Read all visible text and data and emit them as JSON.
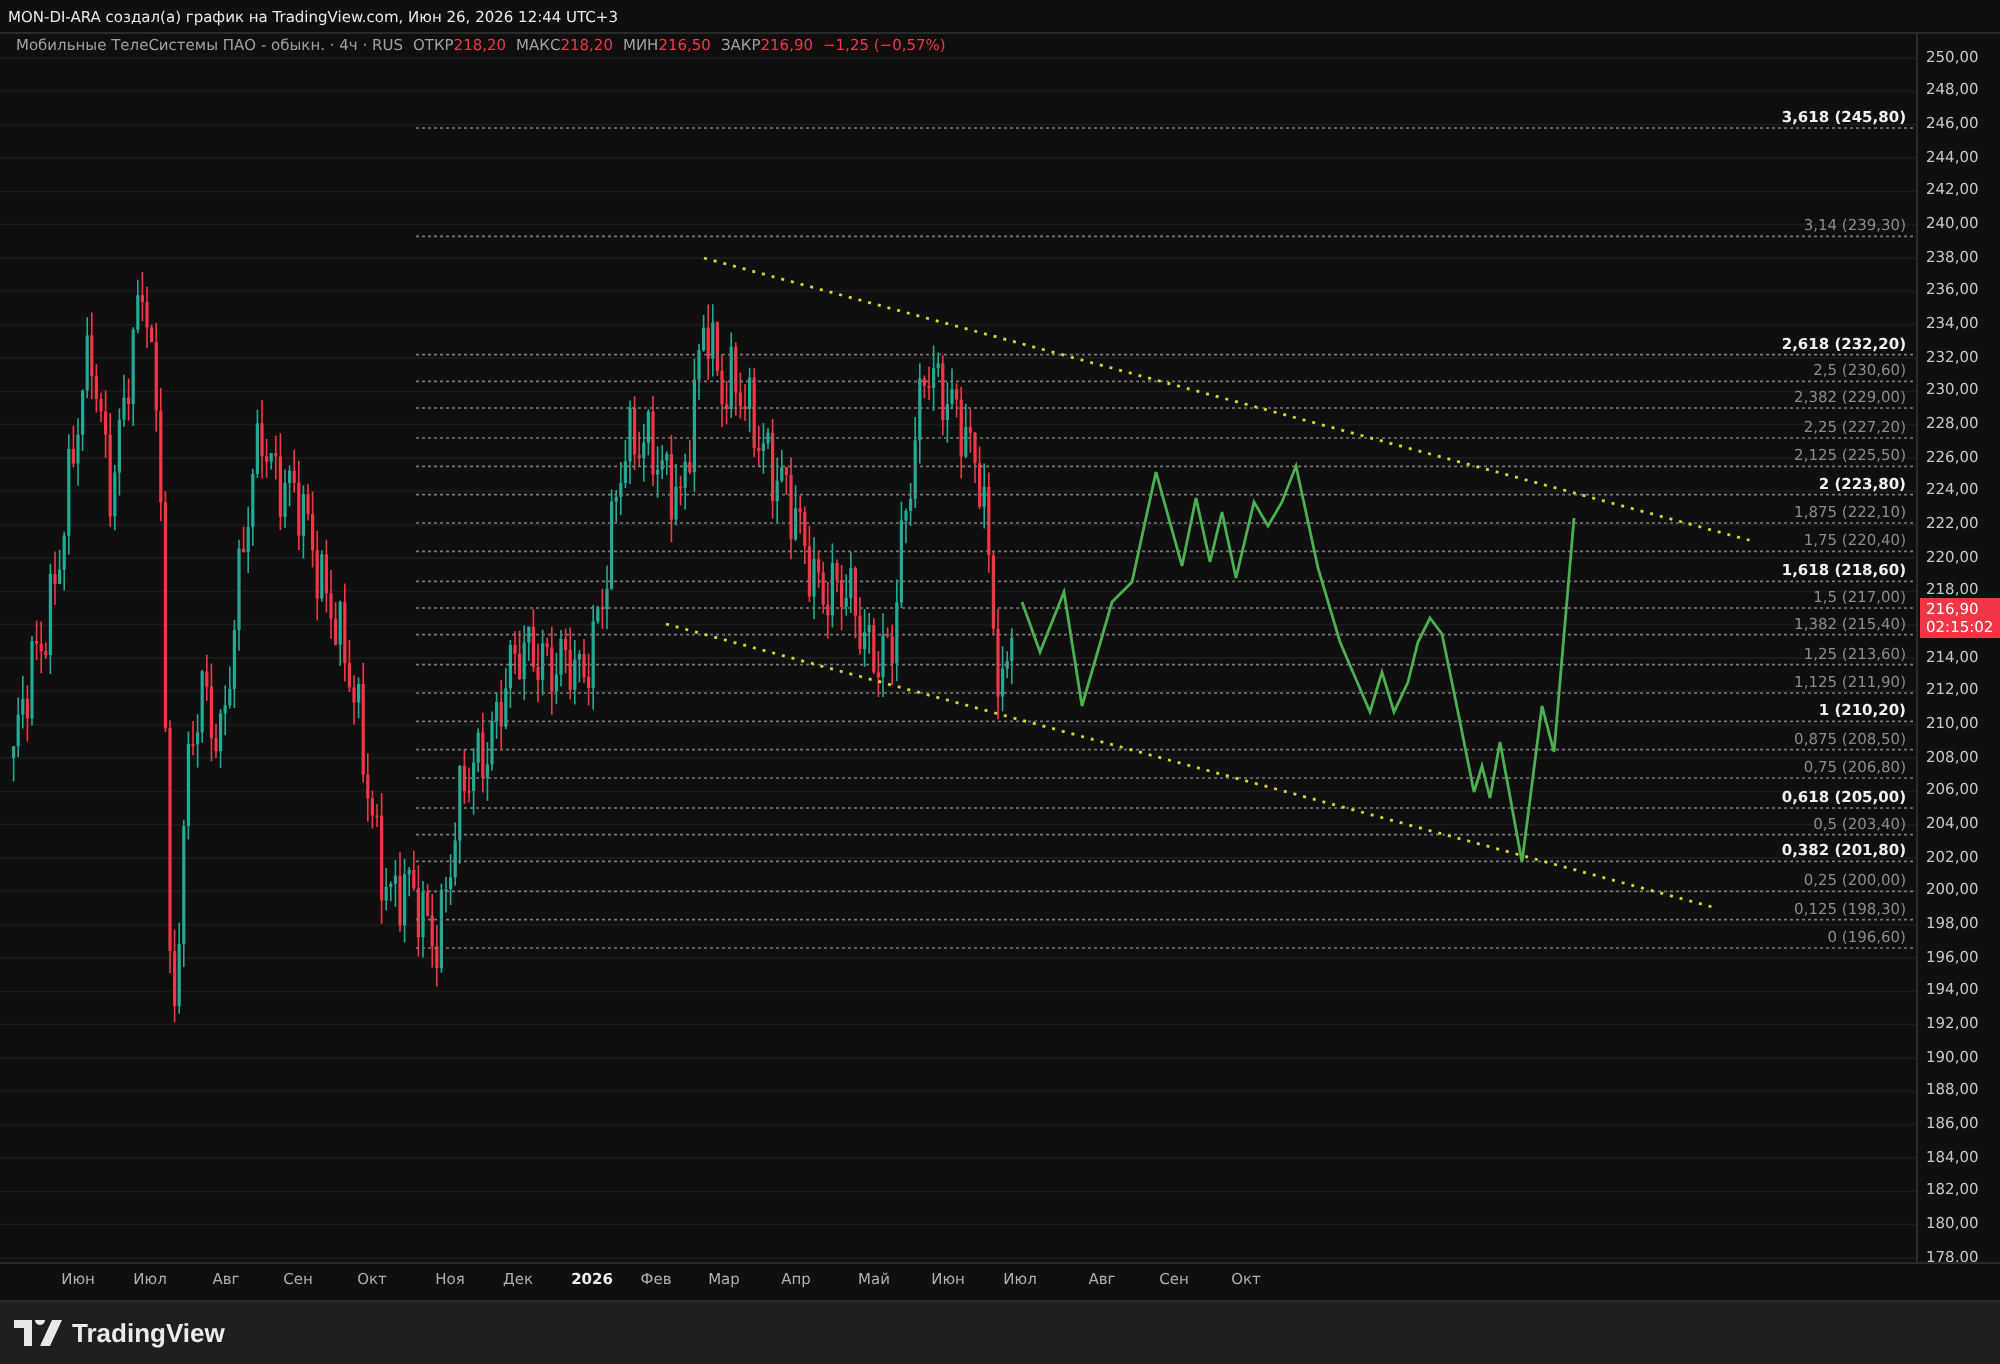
{
  "header": {
    "title": "MON-DI-ARA создал(а) график на TradingView.com, Июн 26, 2026 12:44 UTC+3"
  },
  "legend": {
    "title": "Мобильные ТелеСистемы ПАО - обыкн. · 4ч · RUS",
    "falling": true,
    "ohlc": [
      {
        "label": "ОТКР",
        "value": "218,20"
      },
      {
        "label": "МАКС",
        "value": "218,20"
      },
      {
        "label": "МИН",
        "value": "216,50"
      },
      {
        "label": "ЗАКР",
        "value": "216,90"
      }
    ],
    "change": "−1,25 (−0,57%)"
  },
  "fib_levels": [
    {
      "label": "3,618 (245,80)",
      "bold": true
    },
    {
      "label": "3,14 (239,30)",
      "bold": false
    },
    {
      "label": "2,618 (232,20)",
      "bold": true
    },
    {
      "label": "2,5 (230,60)",
      "bold": false
    },
    {
      "label": "2,382 (229,00)",
      "bold": false
    },
    {
      "label": "2,25 (227,20)",
      "bold": false
    },
    {
      "label": "2,125 (225,50)",
      "bold": false
    },
    {
      "label": "2 (223,80)",
      "bold": true
    },
    {
      "label": "1,875 (222,10)",
      "bold": false
    },
    {
      "label": "1,75 (220,40)",
      "bold": false
    },
    {
      "label": "1,618 (218,60)",
      "bold": true
    },
    {
      "label": "1,5 (217,00)",
      "bold": false
    },
    {
      "label": "1,382 (215,40)",
      "bold": false
    },
    {
      "label": "1,25 (213,60)",
      "bold": false
    },
    {
      "label": "1,125 (211,90)",
      "bold": false
    },
    {
      "label": "1 (210,20)",
      "bold": true
    },
    {
      "label": "0,875 (208,50)",
      "bold": false
    },
    {
      "label": "0,75 (206,80)",
      "bold": false
    },
    {
      "label": "0,618 (205,00)",
      "bold": true
    },
    {
      "label": "0,5 (203,40)",
      "bold": false
    },
    {
      "label": "0,382 (201,80)",
      "bold": true
    },
    {
      "label": "0,25 (200,00)",
      "bold": false
    },
    {
      "label": "0,125 (198,30)",
      "bold": false
    },
    {
      "label": "0 (196,60)",
      "bold": false
    }
  ],
  "price_axis": {
    "labels": [
      "250,00",
      "248,00",
      "246,00",
      "244,00",
      "242,00",
      "240,00",
      "238,00",
      "236,00",
      "234,00",
      "232,00",
      "230,00",
      "228,00",
      "226,00",
      "224,00",
      "222,00",
      "220,00",
      "218,00",
      "214,00",
      "212,00",
      "210,00",
      "208,00",
      "206,00",
      "204,00",
      "202,00",
      "200,00",
      "198,00",
      "196,00",
      "194,00",
      "192,00",
      "190,00",
      "188,00",
      "186,00",
      "184,00",
      "182,00",
      "180,00",
      "178,00"
    ]
  },
  "last_price": {
    "price": "216,90",
    "countdown": "02:15:02"
  },
  "time_axis": {
    "labels": [
      {
        "text": "Июн",
        "bold": false
      },
      {
        "text": "Июл",
        "bold": false
      },
      {
        "text": "Авг",
        "bold": false
      },
      {
        "text": "Сен",
        "bold": false
      },
      {
        "text": "Окт",
        "bold": false
      },
      {
        "text": "Ноя",
        "bold": false
      },
      {
        "text": "Дек",
        "bold": false
      },
      {
        "text": "2026",
        "bold": true
      },
      {
        "text": "Фев",
        "bold": false
      },
      {
        "text": "Мар",
        "bold": false
      },
      {
        "text": "Апр",
        "bold": false
      },
      {
        "text": "Май",
        "bold": false
      },
      {
        "text": "Июн",
        "bold": false
      },
      {
        "text": "Июл",
        "bold": false
      },
      {
        "text": "Авг",
        "bold": false
      },
      {
        "text": "Сен",
        "bold": false
      },
      {
        "text": "Окт",
        "bold": false
      }
    ]
  },
  "brand": {
    "name": "TradingView"
  }
}
